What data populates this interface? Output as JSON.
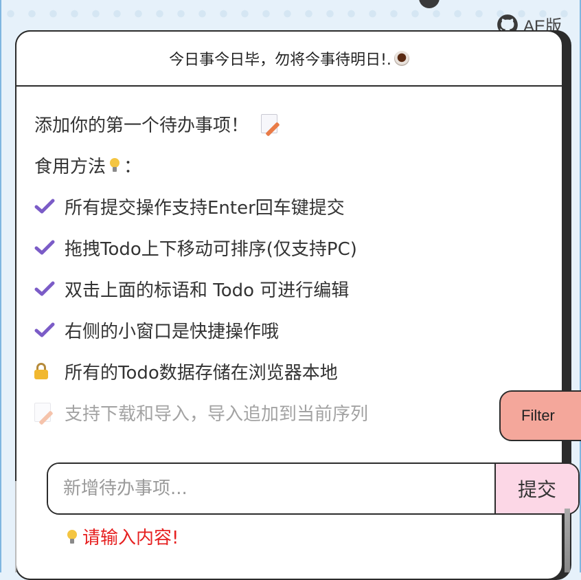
{
  "header": {
    "github_label": "AE版",
    "motto": "今日事今日毕，勿将今事待明日!."
  },
  "empty_state": {
    "title": "添加你的第一个待办事项！",
    "usage_label": "食用方法",
    "usage_colon": "：",
    "tips": [
      {
        "icon": "check-icon",
        "text": "所有提交操作支持Enter回车键提交"
      },
      {
        "icon": "check-icon",
        "text": "拖拽Todo上下移动可排序(仅支持PC)"
      },
      {
        "icon": "check-icon",
        "text": "双击上面的标语和 Todo 可进行编辑"
      },
      {
        "icon": "check-icon",
        "text": "右侧的小窗口是快捷操作哦"
      },
      {
        "icon": "lock-icon",
        "text": "所有的Todo数据存储在浏览器本地"
      },
      {
        "icon": "memo-icon",
        "text": "支持下载和导入，导入追加到当前序列"
      }
    ]
  },
  "input": {
    "placeholder": "新增待办事项...",
    "value": "",
    "submit_label": "提交"
  },
  "warning": "请输入内容!",
  "filter_label": "Filter",
  "colors": {
    "accent_check": "#7b5cc7",
    "submit_bg": "#fcd7e6",
    "filter_bg": "#f4a79b",
    "warning": "#e62020",
    "background": "#e6f1fa"
  }
}
